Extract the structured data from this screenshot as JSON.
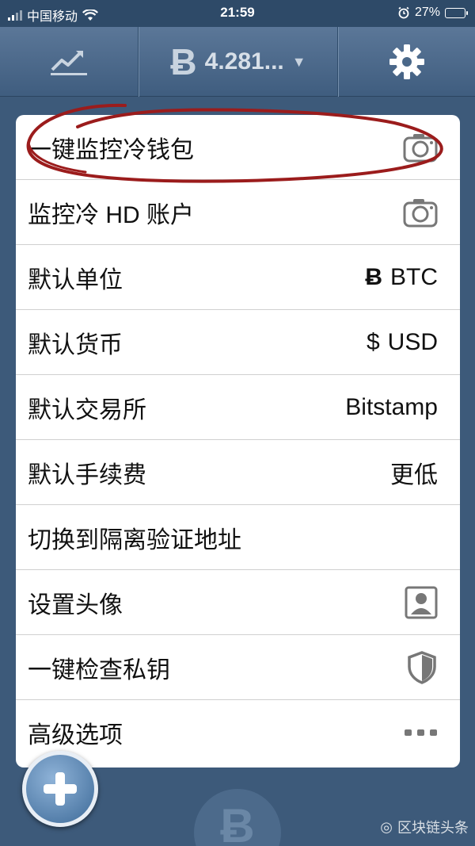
{
  "status_bar": {
    "carrier": "中国移动",
    "time": "21:59",
    "battery": "27%"
  },
  "toolbar": {
    "wallet_symbol": "Ƀ",
    "wallet_balance": "4.281...",
    "chart_icon": "trend-chart-icon",
    "settings_icon": "gear-icon"
  },
  "menu": {
    "items": [
      {
        "label": "一键监控冷钱包",
        "icon": "camera-icon"
      },
      {
        "label": "监控冷 HD 账户",
        "icon": "camera-icon"
      },
      {
        "label": "默认单位",
        "value_symbol": "Ƀ",
        "value": "BTC"
      },
      {
        "label": "默认货币",
        "value_symbol": "$",
        "value": "USD"
      },
      {
        "label": "默认交易所",
        "value": "Bitstamp"
      },
      {
        "label": "默认手续费",
        "value": "更低"
      },
      {
        "label": "切换到隔离验证地址"
      },
      {
        "label": "设置头像",
        "icon": "avatar-icon"
      },
      {
        "label": "一键检查私钥",
        "icon": "shield-icon"
      },
      {
        "label": "高级选项",
        "icon": "more-dots-icon"
      }
    ]
  },
  "annotation_color": "#9b1c1c",
  "bottom_coin_symbol": "Ƀ",
  "watermark": "区块链头条"
}
